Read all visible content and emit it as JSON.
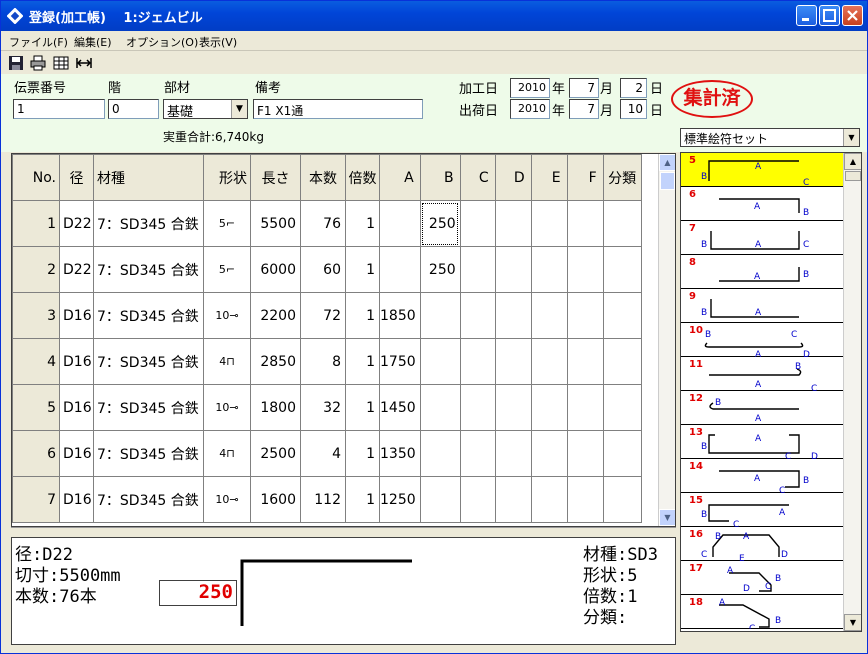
{
  "window": {
    "title": "登録(加工帳)　 1:ジェムビル"
  },
  "menu": [
    "ファイル(F)",
    "編集(E)",
    "オプション(O)",
    "表示(V)"
  ],
  "header": {
    "slip_no_label": "伝票番号",
    "slip_no": "1",
    "floor_label": "階",
    "floor": "0",
    "part_label": "部材",
    "part": "基礎",
    "remarks_label": "備考",
    "remarks": "F1 X1通",
    "proc_date_label": "加工日",
    "proc_year": "2010",
    "proc_month": "7",
    "proc_day": "2",
    "ship_date_label": "出荷日",
    "ship_year": "2010",
    "ship_month": "7",
    "ship_day": "10",
    "year_unit": "年",
    "month_unit": "月",
    "day_unit": "日",
    "stamp": "集計済",
    "total_weight": "実重合計:6,740kg"
  },
  "grid": {
    "columns": [
      "No.",
      "径",
      "材種",
      "形状",
      "長さ",
      "本数",
      "倍数",
      "A",
      "B",
      "C",
      "D",
      "E",
      "F",
      "分類"
    ],
    "rows": [
      {
        "no": "1",
        "dia": "D22",
        "mat": "7：SD345 合鉄",
        "shape": "5",
        "len": "5500",
        "qty": "76",
        "mult": "1",
        "a": "",
        "b": "250"
      },
      {
        "no": "2",
        "dia": "D22",
        "mat": "7：SD345 合鉄",
        "shape": "5",
        "len": "6000",
        "qty": "60",
        "mult": "1",
        "a": "",
        "b": "250"
      },
      {
        "no": "3",
        "dia": "D16",
        "mat": "7：SD345 合鉄",
        "shape": "10",
        "len": "2200",
        "qty": "72",
        "mult": "1",
        "a": "1850",
        "b": ""
      },
      {
        "no": "4",
        "dia": "D16",
        "mat": "7：SD345 合鉄",
        "shape": "4",
        "len": "2850",
        "qty": "8",
        "mult": "1",
        "a": "1750",
        "b": ""
      },
      {
        "no": "5",
        "dia": "D16",
        "mat": "7：SD345 合鉄",
        "shape": "10",
        "len": "1800",
        "qty": "32",
        "mult": "1",
        "a": "1450",
        "b": ""
      },
      {
        "no": "6",
        "dia": "D16",
        "mat": "7：SD345 合鉄",
        "shape": "4",
        "len": "2500",
        "qty": "4",
        "mult": "1",
        "a": "1350",
        "b": ""
      },
      {
        "no": "7",
        "dia": "D16",
        "mat": "7：SD345 合鉄",
        "shape": "10",
        "len": "1600",
        "qty": "112",
        "mult": "1",
        "a": "1250",
        "b": ""
      }
    ]
  },
  "detail": {
    "dia": "径:D22",
    "cut": "切寸:5500mm",
    "qty": "本数:76本",
    "value": "250",
    "mat": "材種:SD3",
    "shape": "形状:5",
    "mult": "倍数:1",
    "class": "分類:"
  },
  "palette": {
    "set_name": "標準絵符セット",
    "items": [
      "5",
      "6",
      "7",
      "8",
      "9",
      "10",
      "11",
      "12",
      "13",
      "14",
      "15",
      "16",
      "17",
      "18"
    ]
  }
}
